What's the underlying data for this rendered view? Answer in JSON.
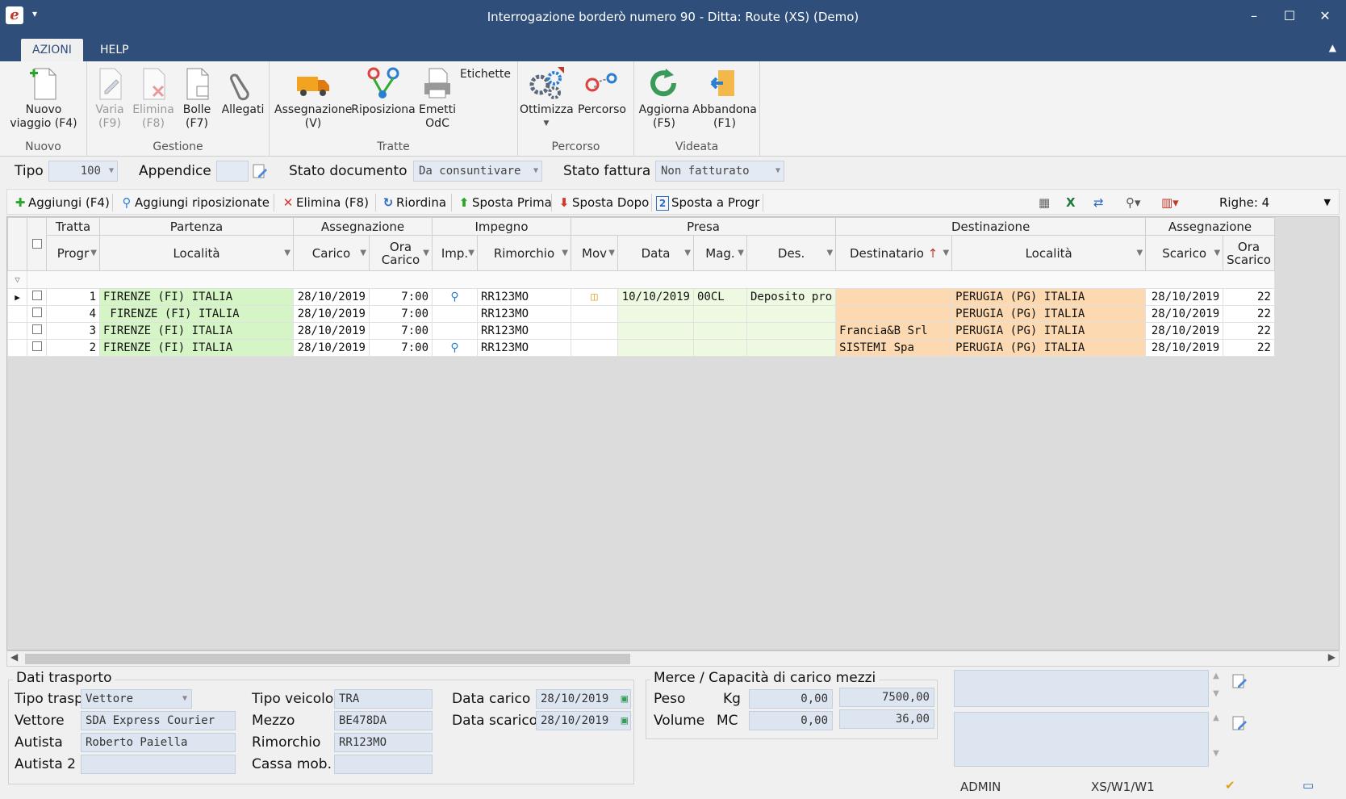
{
  "window": {
    "title": "Interrogazione borderò numero 90 - Ditta: Route (XS)  (Demo)",
    "app_icon": "e",
    "qat_icon": "dropdown-icon"
  },
  "ribbon_tabs": [
    "AZIONI",
    "HELP"
  ],
  "ribbon": {
    "nuovo": {
      "label": "Nuovo",
      "btn_nuovo_1": "Nuovo",
      "btn_nuovo_2": "viaggio (F4)"
    },
    "gestione": {
      "label": "Gestione",
      "varia_1": "Varia",
      "varia_2": "(F9)",
      "elimina_1": "Elimina",
      "elimina_2": "(F8)",
      "bolle_1": "Bolle",
      "bolle_2": "(F7)",
      "allegati": "Allegati"
    },
    "tratte": {
      "label": "Tratte",
      "assegnazione_1": "Assegnazione",
      "assegnazione_2": "(V)",
      "riposiziona": "Riposiziona",
      "emetti_1": "Emetti",
      "emetti_2": "OdC",
      "etichette": "Etichette"
    },
    "percorso": {
      "label": "Percorso",
      "ottimizza": "Ottimizza",
      "percorso": "Percorso"
    },
    "videata": {
      "label": "Videata",
      "aggiorna_1": "Aggiorna",
      "aggiorna_2": "(F5)",
      "abbandona_1": "Abbandona",
      "abbandona_2": "(F1)"
    }
  },
  "filters": {
    "tipo_label": "Tipo",
    "tipo_value": "100",
    "appendice_label": "Appendice",
    "appendice_value": "",
    "stato_doc_label": "Stato documento",
    "stato_doc_value": "Da consuntivare",
    "stato_fatt_label": "Stato fattura",
    "stato_fatt_value": "Non fatturato"
  },
  "toolbar": {
    "aggiungi": "Aggiungi (F4)",
    "aggiungi_riposizionate": "Aggiungi riposizionate",
    "elimina": "Elimina (F8)",
    "riordina": "Riordina",
    "sposta_prima": "Sposta Prima",
    "sposta_dopo": "Sposta Dopo",
    "sposta_a_progr": "Sposta a Progr",
    "righe": "Righe: 4"
  },
  "grid": {
    "groups": [
      "Tratta",
      "Partenza",
      "Assegnazione",
      "Impegno",
      "Presa",
      "Destinazione",
      "Assegnazione"
    ],
    "columns": [
      "Progr",
      "Località",
      "Carico",
      "Ora Carico",
      "Imp.",
      "Rimorchio",
      "Mov",
      "Data",
      "Mag.",
      "Des.",
      "Destinatario",
      "Località",
      "Scarico",
      "Ora Scarico"
    ],
    "rows": [
      {
        "progr": "1",
        "partenza": "FIRENZE (FI) ITALIA",
        "carico": "28/10/2019",
        "ora_carico": "7:00",
        "rimorchio": "RR123MO",
        "data": "10/10/2019",
        "mag": "00CL",
        "des": "Deposito pro",
        "destinatario": "",
        "dest_localita": "PERUGIA (PG) ITALIA",
        "scarico": "28/10/2019",
        "ora_scarico": "22"
      },
      {
        "progr": "4",
        "partenza": " FIRENZE (FI) ITALIA",
        "carico": "28/10/2019",
        "ora_carico": "7:00",
        "rimorchio": "RR123MO",
        "data": "",
        "mag": "",
        "des": "",
        "destinatario": "",
        "dest_localita": "PERUGIA (PG) ITALIA",
        "scarico": "28/10/2019",
        "ora_scarico": "22"
      },
      {
        "progr": "3",
        "partenza": "FIRENZE (FI) ITALIA",
        "carico": "28/10/2019",
        "ora_carico": "7:00",
        "rimorchio": "RR123MO",
        "data": "",
        "mag": "",
        "des": "",
        "destinatario": "Francia&B Srl",
        "dest_localita": "PERUGIA (PG) ITALIA",
        "scarico": "28/10/2019",
        "ora_scarico": "22"
      },
      {
        "progr": "2",
        "partenza": "FIRENZE (FI) ITALIA",
        "carico": "28/10/2019",
        "ora_carico": "7:00",
        "rimorchio": "RR123MO",
        "data": "",
        "mag": "",
        "des": "",
        "destinatario": "SISTEMI Spa",
        "dest_localita": "PERUGIA (PG) ITALIA",
        "scarico": "28/10/2019",
        "ora_scarico": "22"
      }
    ]
  },
  "dati_trasporto": {
    "legend": "Dati trasporto",
    "tipo_trasp_label": "Tipo trasp",
    "tipo_trasp_value": "Vettore",
    "vettore_label": "Vettore",
    "vettore_value": "SDA Express Courier",
    "autista_label": "Autista",
    "autista_value": "Roberto Paiella",
    "autista2_label": "Autista 2",
    "autista2_value": "",
    "tipo_veicolo_label": "Tipo veicolo",
    "tipo_veicolo_value": "TRA",
    "mezzo_label": "Mezzo",
    "mezzo_value": "BE478DA",
    "rimorchio_label": "Rimorchio",
    "rimorchio_value": "RR123MO",
    "cassa_label": "Cassa mob.",
    "cassa_value": "",
    "data_carico_label": "Data carico",
    "data_carico_value": "28/10/2019",
    "data_scarico_label": "Data scarico",
    "data_scarico_value": "28/10/2019"
  },
  "merce": {
    "legend": "Merce / Capacità di carico mezzi",
    "peso_label": "Peso",
    "peso_unit": "Kg",
    "peso_value": "0,00",
    "peso_cap": "7500,00",
    "volume_label": "Volume",
    "volume_unit": "MC",
    "volume_value": "0,00",
    "volume_cap": "36,00"
  },
  "status": {
    "user": "ADMIN",
    "path": "XS/W1/W1"
  }
}
